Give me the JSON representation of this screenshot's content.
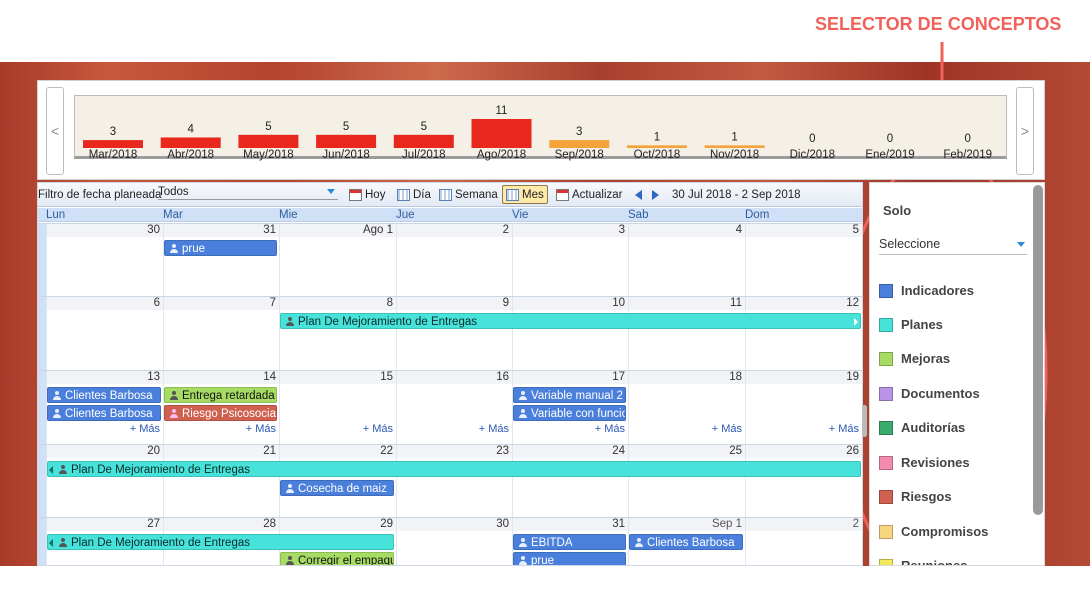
{
  "annotation": {
    "title": "SELECTOR DE CONCEPTOS",
    "color": "#f0615a"
  },
  "chart_data": {
    "type": "bar",
    "categories": [
      "Mar/2018",
      "Abr/2018",
      "May/2018",
      "Jun/2018",
      "Jul/2018",
      "Ago/2018",
      "Sep/2018",
      "Oct/2018",
      "Nov/2018",
      "Dic/2018",
      "Ene/2019",
      "Feb/2019"
    ],
    "values": [
      3,
      4,
      5,
      5,
      5,
      11,
      3,
      1,
      1,
      0,
      0,
      0
    ],
    "colors": [
      "#e8281c",
      "#e8281c",
      "#e8281c",
      "#e8281c",
      "#e8281c",
      "#e8281c",
      "#f4a23a",
      "#f4a23a",
      "#f4a23a",
      "#f4a23a",
      "#f4a23a",
      "#f4a23a"
    ],
    "ylim": [
      0,
      11
    ]
  },
  "nav": {
    "prev": "<",
    "next": ">"
  },
  "toolbar": {
    "filter_label": "Filtro de fecha planeada",
    "filter_value": "Todos",
    "today": "Hoy",
    "day": "Día",
    "week": "Semana",
    "month": "Mes",
    "refresh": "Actualizar",
    "range": "30 Jul 2018 - 2 Sep 2018"
  },
  "daynames": [
    "Lun",
    "Mar",
    "Mie",
    "Jue",
    "Vie",
    "Sab",
    "Dom"
  ],
  "weeks": [
    {
      "days": [
        "30",
        "31",
        "Ago 1",
        "2",
        "3",
        "4",
        "5"
      ]
    },
    {
      "days": [
        "6",
        "7",
        "8",
        "9",
        "10",
        "11",
        "12"
      ]
    },
    {
      "days": [
        "13",
        "14",
        "15",
        "16",
        "17",
        "18",
        "19"
      ],
      "mas": "+ Más"
    },
    {
      "days": [
        "20",
        "21",
        "22",
        "23",
        "24",
        "25",
        "26"
      ]
    },
    {
      "days": [
        "27",
        "28",
        "29",
        "30",
        "31",
        "Sep 1",
        "2"
      ]
    }
  ],
  "events": {
    "w1_prue": "prue",
    "w2_plan": "Plan De Mejoramiento de Entregas",
    "w3_clientes1": "Clientes Barbosa",
    "w3_clientes2": "Clientes Barbosa",
    "w3_entrega": "Entrega retardada",
    "w3_riesgo": "Riesgo Psicosocial",
    "w3_variable1": "Variable manual 2",
    "w3_variable2": "Variable con funcion",
    "w4_plan": "Plan De Mejoramiento de Entregas",
    "w4_cosecha": "Cosecha de maiz",
    "w5_plan": "Plan De Mejoramiento de Entregas",
    "w5_corregir": "Corregir el empaque",
    "w5_ebitda": "EBITDA",
    "w5_prue": "prue",
    "w5_clientes": "Clientes Barbosa"
  },
  "sidebar": {
    "solo": "Solo",
    "select": "Seleccione",
    "concepts": [
      {
        "label": "Indicadores",
        "color": "#4a7fdb"
      },
      {
        "label": "Planes",
        "color": "#47e3da"
      },
      {
        "label": "Mejoras",
        "color": "#a6dc63"
      },
      {
        "label": "Documentos",
        "color": "#b994e6"
      },
      {
        "label": "Auditorías",
        "color": "#3aaa6e"
      },
      {
        "label": "Revisiones",
        "color": "#f28bb0"
      },
      {
        "label": "Riesgos",
        "color": "#d0604f"
      },
      {
        "label": "Compromisos",
        "color": "#f7d57c"
      },
      {
        "label": "Reuniones",
        "color": "#f2ea5c"
      }
    ]
  }
}
